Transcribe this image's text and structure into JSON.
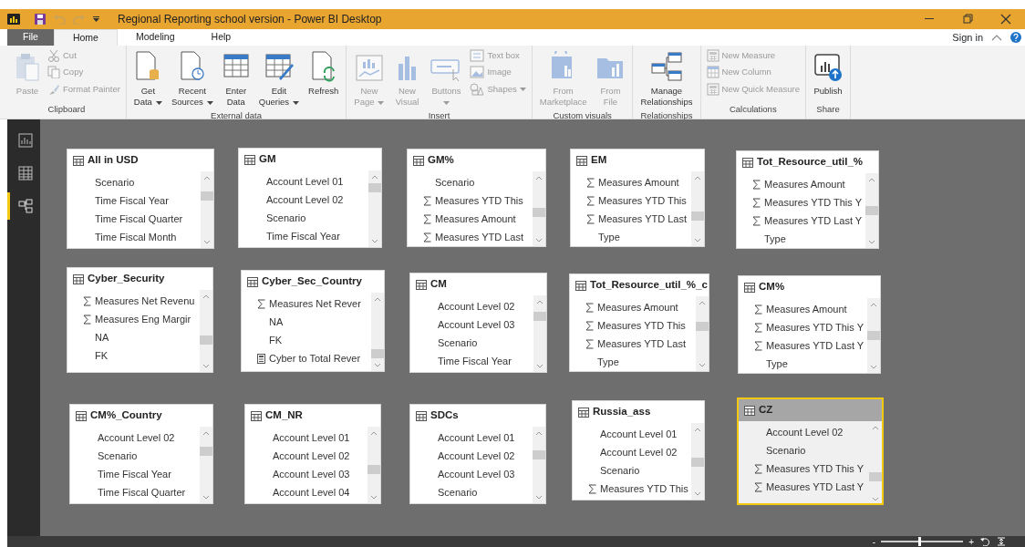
{
  "window": {
    "title": "Regional Reporting school version - Power BI Desktop"
  },
  "menu_tabs": [
    {
      "label": "File",
      "kind": "file",
      "selected": false
    },
    {
      "label": "Home",
      "kind": "tab",
      "selected": true
    },
    {
      "label": "Modeling",
      "kind": "tab",
      "selected": false
    },
    {
      "label": "Help",
      "kind": "tab",
      "selected": false
    }
  ],
  "sign_in": "Sign in",
  "ribbon": [
    {
      "name": "Clipboard",
      "items": [
        {
          "kind": "large",
          "lines": [
            "Paste"
          ],
          "disabled": true,
          "dropdown": false
        },
        {
          "kind": "small",
          "lines": [
            "Cut"
          ],
          "disabled": true,
          "dropdown": false
        },
        {
          "kind": "small",
          "lines": [
            "Copy"
          ],
          "disabled": true,
          "dropdown": false
        },
        {
          "kind": "small",
          "lines": [
            "Format Painter"
          ],
          "disabled": true,
          "dropdown": false
        }
      ]
    },
    {
      "name": "External data",
      "items": [
        {
          "kind": "large",
          "lines": [
            "Get",
            "Data"
          ],
          "disabled": false,
          "dropdown": true
        },
        {
          "kind": "large",
          "lines": [
            "Recent",
            "Sources"
          ],
          "disabled": false,
          "dropdown": true
        },
        {
          "kind": "large",
          "lines": [
            "Enter",
            "Data"
          ],
          "disabled": false,
          "dropdown": false
        },
        {
          "kind": "large",
          "lines": [
            "Edit",
            "Queries"
          ],
          "disabled": false,
          "dropdown": true
        },
        {
          "kind": "large",
          "lines": [
            "Refresh"
          ],
          "disabled": false,
          "dropdown": false
        }
      ]
    },
    {
      "name": "Insert",
      "items": [
        {
          "kind": "large",
          "lines": [
            "New",
            "Page"
          ],
          "disabled": true,
          "dropdown": true
        },
        {
          "kind": "large",
          "lines": [
            "New",
            "Visual"
          ],
          "disabled": true,
          "dropdown": false
        },
        {
          "kind": "large",
          "lines": [
            "Buttons"
          ],
          "disabled": true,
          "dropdown": true
        },
        {
          "kind": "small",
          "lines": [
            "Text box"
          ],
          "disabled": true,
          "dropdown": false
        },
        {
          "kind": "small",
          "lines": [
            "Image"
          ],
          "disabled": true,
          "dropdown": false
        },
        {
          "kind": "small",
          "lines": [
            "Shapes"
          ],
          "disabled": true,
          "dropdown": true
        }
      ]
    },
    {
      "name": "Custom visuals",
      "items": [
        {
          "kind": "large",
          "lines": [
            "From",
            "Marketplace"
          ],
          "disabled": true,
          "dropdown": false
        },
        {
          "kind": "large",
          "lines": [
            "From",
            "File"
          ],
          "disabled": true,
          "dropdown": false
        }
      ]
    },
    {
      "name": "Relationships",
      "items": [
        {
          "kind": "large",
          "lines": [
            "Manage",
            "Relationships"
          ],
          "disabled": false,
          "dropdown": false
        }
      ]
    },
    {
      "name": "Calculations",
      "items": [
        {
          "kind": "small",
          "lines": [
            "New Measure"
          ],
          "disabled": true,
          "dropdown": false
        },
        {
          "kind": "small",
          "lines": [
            "New Column"
          ],
          "disabled": true,
          "dropdown": false
        },
        {
          "kind": "small",
          "lines": [
            "New Quick Measure"
          ],
          "disabled": true,
          "dropdown": false
        }
      ]
    },
    {
      "name": "Share",
      "items": [
        {
          "kind": "large",
          "lines": [
            "Publish"
          ],
          "disabled": false,
          "dropdown": false
        }
      ]
    }
  ],
  "views": [
    {
      "selected": false
    },
    {
      "selected": false
    },
    {
      "selected": true
    }
  ],
  "tables": [
    {
      "title": "All in USD",
      "selected": false,
      "fields": [
        {
          "label": "Scenario",
          "kind": "plain"
        },
        {
          "label": "Time Fiscal Year",
          "kind": "plain"
        },
        {
          "label": "Time Fiscal Quarter",
          "kind": "plain"
        },
        {
          "label": "Time Fiscal Month",
          "kind": "plain"
        }
      ]
    },
    {
      "title": "GM",
      "selected": false,
      "fields": [
        {
          "label": "Account Level 01",
          "kind": "plain"
        },
        {
          "label": "Account Level 02",
          "kind": "plain"
        },
        {
          "label": "Scenario",
          "kind": "plain"
        },
        {
          "label": "Time Fiscal Year",
          "kind": "plain"
        }
      ]
    },
    {
      "title": "GM%",
      "selected": false,
      "fields": [
        {
          "label": "Scenario",
          "kind": "plain"
        },
        {
          "label": "Measures YTD This",
          "kind": "sigma"
        },
        {
          "label": "Measures Amount",
          "kind": "sigma"
        },
        {
          "label": "Measures YTD Last",
          "kind": "sigma"
        }
      ]
    },
    {
      "title": "EM",
      "selected": false,
      "fields": [
        {
          "label": "Measures Amount",
          "kind": "sigma"
        },
        {
          "label": "Measures YTD This",
          "kind": "sigma"
        },
        {
          "label": "Measures YTD Last",
          "kind": "sigma"
        },
        {
          "label": "Type",
          "kind": "plain"
        }
      ]
    },
    {
      "title": "Tot_Resource_util_%",
      "selected": false,
      "fields": [
        {
          "label": "Measures Amount",
          "kind": "sigma"
        },
        {
          "label": "Measures YTD This Y",
          "kind": "sigma"
        },
        {
          "label": "Measures YTD Last Y",
          "kind": "sigma"
        },
        {
          "label": "Type",
          "kind": "plain"
        }
      ]
    },
    {
      "title": "Cyber_Security",
      "selected": false,
      "fields": [
        {
          "label": "Measures Net Revenu",
          "kind": "sigma"
        },
        {
          "label": "Measures Eng Margir",
          "kind": "sigma"
        },
        {
          "label": "NA",
          "kind": "plain"
        },
        {
          "label": "FK",
          "kind": "plain"
        }
      ]
    },
    {
      "title": "Cyber_Sec_Country",
      "selected": false,
      "fields": [
        {
          "label": "Measures Net Rever",
          "kind": "sigma"
        },
        {
          "label": "NA",
          "kind": "plain"
        },
        {
          "label": "FK",
          "kind": "plain"
        },
        {
          "label": "Cyber to Total Rever",
          "kind": "calc"
        }
      ]
    },
    {
      "title": "CM",
      "selected": false,
      "fields": [
        {
          "label": "Account Level 02",
          "kind": "plain"
        },
        {
          "label": "Account Level 03",
          "kind": "plain"
        },
        {
          "label": "Scenario",
          "kind": "plain"
        },
        {
          "label": "Time Fiscal Year",
          "kind": "plain"
        }
      ]
    },
    {
      "title": "Tot_Resource_util_%_c",
      "selected": false,
      "fields": [
        {
          "label": "Measures Amount",
          "kind": "sigma"
        },
        {
          "label": "Measures YTD This",
          "kind": "sigma"
        },
        {
          "label": "Measures YTD Last",
          "kind": "sigma"
        },
        {
          "label": "Type",
          "kind": "plain"
        }
      ]
    },
    {
      "title": "CM%",
      "selected": false,
      "fields": [
        {
          "label": "Measures Amount",
          "kind": "sigma"
        },
        {
          "label": "Measures YTD This Y",
          "kind": "sigma"
        },
        {
          "label": "Measures YTD Last Y",
          "kind": "sigma"
        },
        {
          "label": "Type",
          "kind": "plain"
        }
      ]
    },
    {
      "title": "CM%_Country",
      "selected": false,
      "fields": [
        {
          "label": "Account Level 02",
          "kind": "plain"
        },
        {
          "label": "Scenario",
          "kind": "plain"
        },
        {
          "label": "Time Fiscal Year",
          "kind": "plain"
        },
        {
          "label": "Time Fiscal Quarter",
          "kind": "plain"
        }
      ]
    },
    {
      "title": "CM_NR",
      "selected": false,
      "fields": [
        {
          "label": "Account Level 01",
          "kind": "plain"
        },
        {
          "label": "Account Level 02",
          "kind": "plain"
        },
        {
          "label": "Account Level 03",
          "kind": "plain"
        },
        {
          "label": "Account Level 04",
          "kind": "plain"
        }
      ]
    },
    {
      "title": "SDCs",
      "selected": false,
      "fields": [
        {
          "label": "Account Level 01",
          "kind": "plain"
        },
        {
          "label": "Account Level 02",
          "kind": "plain"
        },
        {
          "label": "Account Level 03",
          "kind": "plain"
        },
        {
          "label": "Scenario",
          "kind": "plain"
        }
      ]
    },
    {
      "title": "Russia_ass",
      "selected": false,
      "fields": [
        {
          "label": "Account Level 01",
          "kind": "plain"
        },
        {
          "label": "Account Level 02",
          "kind": "plain"
        },
        {
          "label": "Scenario",
          "kind": "plain"
        },
        {
          "label": "Measures YTD This",
          "kind": "sigma"
        }
      ]
    },
    {
      "title": "CZ",
      "selected": true,
      "fields": [
        {
          "label": "Account Level 02",
          "kind": "plain"
        },
        {
          "label": "Scenario",
          "kind": "plain"
        },
        {
          "label": "Measures YTD This Y",
          "kind": "sigma"
        },
        {
          "label": "Measures YTD Last Y",
          "kind": "sigma"
        }
      ]
    }
  ],
  "zoom": {
    "minus": "-",
    "plus": "+",
    "level": 0.45
  }
}
